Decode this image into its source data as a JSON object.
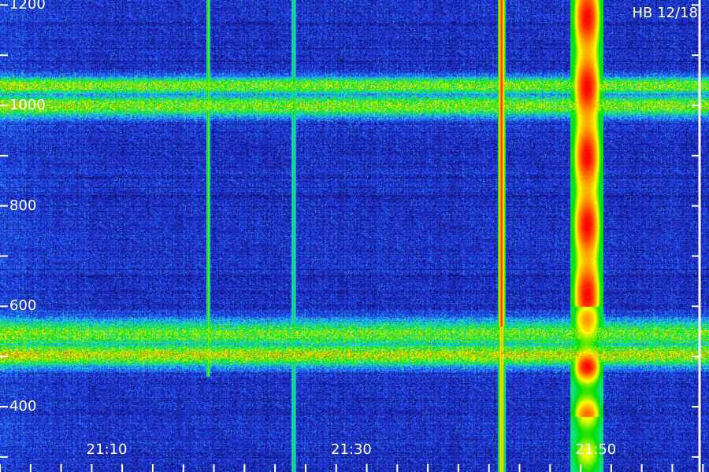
{
  "chart_data": {
    "type": "heatmap",
    "title": "",
    "xlabel": "",
    "ylabel": "",
    "station_label": "HB 12/18",
    "x_range_minutes": [
      "21:01",
      "21:59"
    ],
    "y_range": [
      270,
      1210
    ],
    "x_ticks": [
      {
        "label": "21:10",
        "minute": "21:10"
      },
      {
        "label": "21:30",
        "minute": "21:30"
      },
      {
        "label": "21:50",
        "minute": "21:50"
      }
    ],
    "y_ticks": [
      {
        "label": "1200",
        "value": 1200
      },
      {
        "label": "1000",
        "value": 1000
      },
      {
        "label": "800",
        "value": 800
      },
      {
        "label": "600",
        "value": 600
      },
      {
        "label": "400",
        "value": 400
      }
    ],
    "horizontal_bands": [
      {
        "value": 1040,
        "width": 18,
        "intensity": 0.55
      },
      {
        "value": 1000,
        "width": 22,
        "intensity": 0.55
      },
      {
        "value": 545,
        "width": 30,
        "intensity": 0.5
      },
      {
        "value": 505,
        "width": 25,
        "intensity": 0.6
      }
    ],
    "vertical_events": [
      {
        "start": "21:18",
        "end": "21:18",
        "y_from": 460,
        "y_to": 1210,
        "intensity": 0.8,
        "profile": "narrow-green"
      },
      {
        "start": "21:25",
        "end": "21:25",
        "y_from": 270,
        "y_to": 1210,
        "intensity": 0.55,
        "profile": "narrow-cyan"
      },
      {
        "start": "21:42",
        "end": "21:42",
        "y_from": 270,
        "y_to": 1210,
        "intensity": 0.95,
        "profile": "yellow-red"
      },
      {
        "start": "21:48",
        "end": "21:50",
        "y_from": 270,
        "y_to": 1210,
        "intensity": 1.0,
        "profile": "broad-red"
      }
    ],
    "colormap": [
      "#000033",
      "#1a1a9c",
      "#2450ff",
      "#1ee0e6",
      "#00e000",
      "#ffff00",
      "#ff8000",
      "#ff0000"
    ]
  }
}
